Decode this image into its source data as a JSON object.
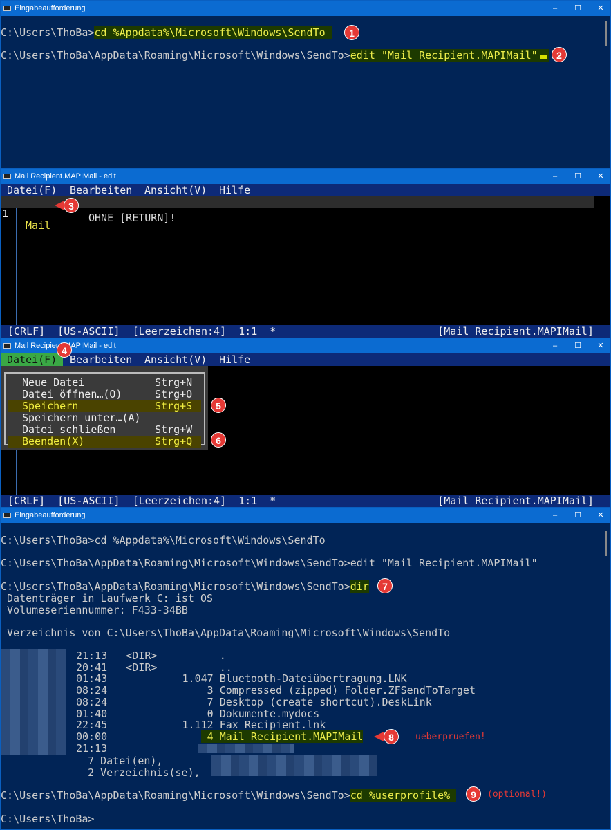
{
  "cmd1": {
    "title": "Eingabeaufforderung",
    "line1_prompt": "C:\\Users\\ThoBa>",
    "line1_cmd": "cd %Appdata%\\Microsoft\\Windows\\SendTo ",
    "line2_prompt": "C:\\Users\\ThoBa\\AppData\\Roaming\\Microsoft\\Windows\\SendTo>",
    "line2_cmd": "edit \"Mail Recipient.MAPIMail\""
  },
  "window_controls": {
    "minimize": "–",
    "maximize": "☐",
    "close": "✕"
  },
  "edit1": {
    "title": "Mail Recipient.MAPIMail - edit",
    "menu": [
      "Datei(F)",
      "Bearbeiten",
      "Ansicht(V)",
      "Hilfe"
    ],
    "line_no": "1",
    "content": "Mail",
    "note": "OHNE [RETURN]!",
    "status_left": "[CRLF]  [US-ASCII]  [Leerzeichen:4]  1:1  *",
    "status_right": "[Mail Recipient.MAPIMail]"
  },
  "edit2": {
    "title": "Mail Recipient.MAPIMail - edit",
    "menu": [
      "Datei(F)",
      "Bearbeiten",
      "Ansicht(V)",
      "Hilfe"
    ],
    "dropdown": [
      {
        "label": "Neue Datei",
        "key": "Strg+N"
      },
      {
        "label": "Datei öffnen…(O)",
        "key": "Strg+O"
      },
      {
        "label": "Speichern",
        "key": "Strg+S"
      },
      {
        "label": "Speichern unter…(A)",
        "key": ""
      },
      {
        "label": "Datei schließen",
        "key": "Strg+W"
      },
      {
        "label": "Beenden(X)",
        "key": "Strg+Q"
      }
    ],
    "status_left": "[CRLF]  [US-ASCII]  [Leerzeichen:4]  1:1  *",
    "status_right": "[Mail Recipient.MAPIMail]"
  },
  "cmd2": {
    "title": "Eingabeaufforderung",
    "lines": [
      "C:\\Users\\ThoBa>cd %Appdata%\\Microsoft\\Windows\\SendTo",
      "C:\\Users\\ThoBa\\AppData\\Roaming\\Microsoft\\Windows\\SendTo>edit \"Mail Recipient.MAPIMail\""
    ],
    "prompt": "C:\\Users\\ThoBa\\AppData\\Roaming\\Microsoft\\Windows\\SendTo>",
    "dir_cmd": "dir",
    "vol1": " Datenträger in Laufwerk C: ist OS",
    "vol2": " Volumeseriennummer: F433-34BB",
    "dirof": " Verzeichnis von C:\\Users\\ThoBa\\AppData\\Roaming\\Microsoft\\Windows\\SendTo",
    "entries": [
      {
        "time": "21:13",
        "col": "   <DIR>          ."
      },
      {
        "time": "20:41",
        "col": "   <DIR>          .."
      },
      {
        "time": "01:43",
        "col": "            1.047 Bluetooth-Dateiübertragung.LNK"
      },
      {
        "time": "08:24",
        "col": "                3 Compressed (zipped) Folder.ZFSendToTarget"
      },
      {
        "time": "08:24",
        "col": "                7 Desktop (create shortcut).DeskLink"
      },
      {
        "time": "01:40",
        "col": "                0 Dokumente.mydocs"
      },
      {
        "time": "22:45",
        "col": "            1.112 Fax Recipient.lnk"
      },
      {
        "time": "00:00",
        "col": "                4 Mail Recipient.MAPIMail"
      },
      {
        "time": "21:13",
        "col": ""
      }
    ],
    "files": "   7 Datei(en),",
    "dirs": "   2 Verzeichnis(se),",
    "cd_cmd": "cd %userprofile% ",
    "last_prompt": "C:\\Users\\ThoBa>",
    "check_note": "ueberpruefen!",
    "optional_note": "(optional!)"
  },
  "badges": [
    "1",
    "2",
    "3",
    "4",
    "5",
    "6",
    "7",
    "8",
    "9"
  ]
}
